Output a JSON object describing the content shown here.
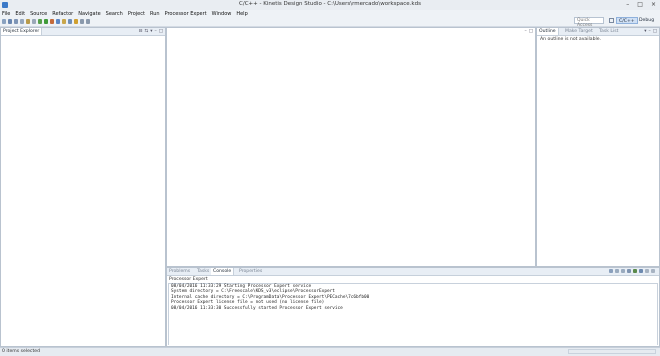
{
  "window": {
    "title": "C/C++ - Kinetis Design Studio - C:\\Users\\rmercado\\workspace.kds",
    "icon": "kds-app-icon"
  },
  "menu": [
    "File",
    "Edit",
    "Source",
    "Refactor",
    "Navigate",
    "Search",
    "Project",
    "Run",
    "Processor Expert",
    "Window",
    "Help"
  ],
  "toolbar": {
    "quick_access_placeholder": "Quick Access",
    "perspectives": [
      "C/C++",
      "Debug"
    ]
  },
  "project_explorer": {
    "tab": "Project Explorer"
  },
  "outline": {
    "tabs": [
      "Outline",
      "Make Target",
      "Task List"
    ],
    "message": "An outline is not available."
  },
  "bottom_panel": {
    "tabs": [
      "Problems",
      "Tasks",
      "Console",
      "Properties"
    ],
    "active_tab": "Console",
    "console_title": "Processor Expert",
    "lines": [
      "08/04/2016 11:33:29 Starting Processor Expert service",
      "System directory = C:\\Freescale\\KDS_v3\\eclipse\\ProcessorExpert",
      "Internal cache directory = C:\\ProgramData\\Processor Expert\\PECache\\7c6bfb00",
      "Processor Expert license file = not used (no license file)",
      "08/04/2016 11:33:30 Successfully started Processor Expert service"
    ]
  },
  "status": {
    "text": "0 items selected"
  },
  "colors": {
    "accent": "#3b79c8",
    "active_perspective": "#cfe0f5"
  }
}
